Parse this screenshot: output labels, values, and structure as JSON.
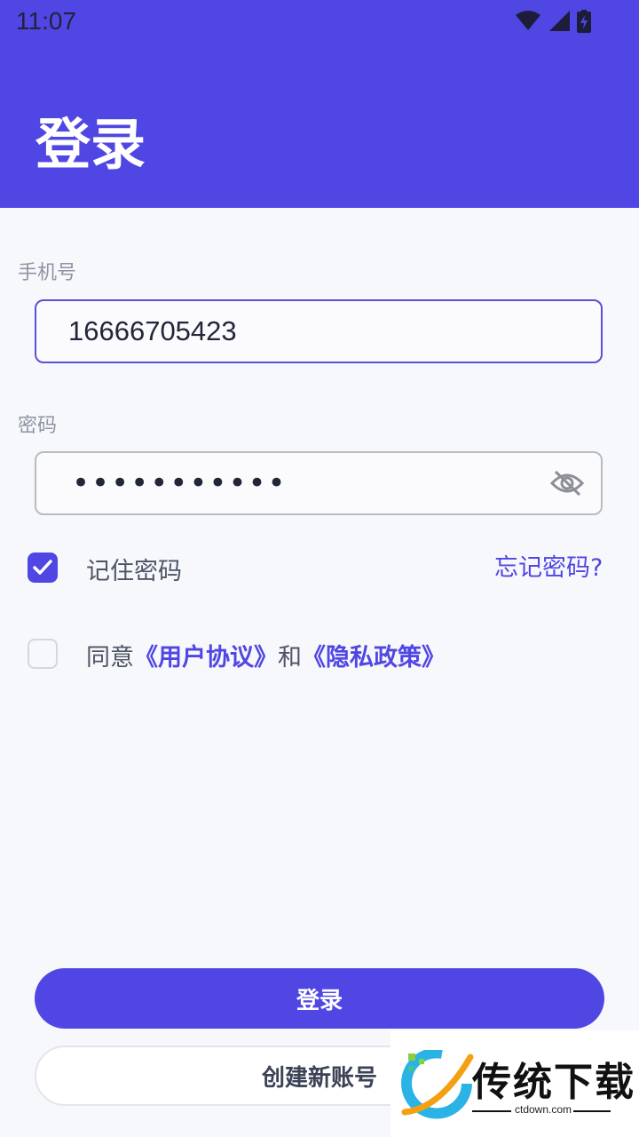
{
  "status_bar": {
    "time": "11:07"
  },
  "header": {
    "title": "登录"
  },
  "phone": {
    "label": "手机号",
    "value": "16666705423"
  },
  "password": {
    "label": "密码",
    "masked_value": "•••••••••••"
  },
  "remember": {
    "label": "记住密码",
    "checked": true
  },
  "forgot_link": "忘记密码?",
  "agreement": {
    "checked": false,
    "prefix": "同意",
    "user_agreement": "《用户协议》",
    "and": "和",
    "privacy_policy": "《隐私政策》"
  },
  "buttons": {
    "login": "登录",
    "register": "创建新账号"
  },
  "watermark": {
    "brand": "传统下载",
    "site": "ctdown.com"
  },
  "colors": {
    "accent": "#5046e4",
    "background": "#f7f8fb"
  },
  "icons": [
    "wifi-icon",
    "cell-signal-icon",
    "battery-charging-icon",
    "eye-off-icon",
    "checkmark-icon"
  ]
}
